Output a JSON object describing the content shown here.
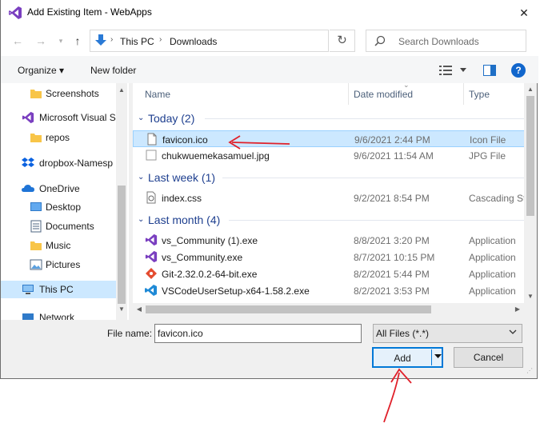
{
  "window": {
    "title": "Add Existing Item - WebApps",
    "close_glyph": "✕"
  },
  "address": {
    "crumbs": [
      "This PC",
      "Downloads"
    ],
    "search_placeholder": "Search Downloads"
  },
  "toolbar": {
    "organize": "Organize ▾",
    "new_folder": "New folder",
    "help": "?"
  },
  "nav": {
    "items": [
      {
        "label": "Screenshots",
        "icon": "folder-icon"
      },
      {
        "label": "Microsoft Visual S",
        "icon": "visual-studio-icon"
      },
      {
        "label": "repos",
        "icon": "folder-icon"
      },
      {
        "label": "dropbox-Namesp",
        "icon": "dropbox-icon"
      },
      {
        "label": "OneDrive",
        "icon": "onedrive-icon"
      },
      {
        "label": "Desktop",
        "icon": "desktop-icon"
      },
      {
        "label": "Documents",
        "icon": "documents-icon"
      },
      {
        "label": "Music",
        "icon": "music-icon"
      },
      {
        "label": "Pictures",
        "icon": "pictures-icon"
      },
      {
        "label": "This PC",
        "icon": "this-pc-icon",
        "selected": true
      },
      {
        "label": "Network",
        "icon": "network-icon"
      }
    ]
  },
  "columns": {
    "name": "Name",
    "date": "Date modified",
    "type": "Type"
  },
  "groups": [
    {
      "label": "Today (2)",
      "files": [
        {
          "name": "favicon.ico",
          "date": "9/6/2021 2:44 PM",
          "type": "Icon File",
          "icon": "icon-file-icon",
          "selected": true
        },
        {
          "name": "chukwuemekasamuel.jpg",
          "date": "9/6/2021 11:54 AM",
          "type": "JPG File",
          "icon": "image-file-icon"
        }
      ]
    },
    {
      "label": "Last week (1)",
      "files": [
        {
          "name": "index.css",
          "date": "9/2/2021 8:54 PM",
          "type": "Cascading St",
          "icon": "css-file-icon"
        }
      ]
    },
    {
      "label": "Last month (4)",
      "files": [
        {
          "name": "vs_Community (1).exe",
          "date": "8/8/2021 3:20 PM",
          "type": "Application",
          "icon": "visual-studio-icon"
        },
        {
          "name": "vs_Community.exe",
          "date": "8/7/2021 10:15 PM",
          "type": "Application",
          "icon": "visual-studio-icon"
        },
        {
          "name": "Git-2.32.0.2-64-bit.exe",
          "date": "8/2/2021 5:44 PM",
          "type": "Application",
          "icon": "git-icon"
        },
        {
          "name": "VSCodeUserSetup-x64-1.58.2.exe",
          "date": "8/2/2021 3:53 PM",
          "type": "Application",
          "icon": "vscode-icon"
        }
      ]
    }
  ],
  "bottom": {
    "file_name_label": "File name:",
    "file_name_value": "favicon.ico",
    "file_type": "All Files (*.*)",
    "add": "Add",
    "cancel": "Cancel"
  },
  "colors": {
    "accent": "#0078d7",
    "selection": "#cce8ff",
    "group_text": "#1e3f8f",
    "annotation": "#e0202a"
  }
}
